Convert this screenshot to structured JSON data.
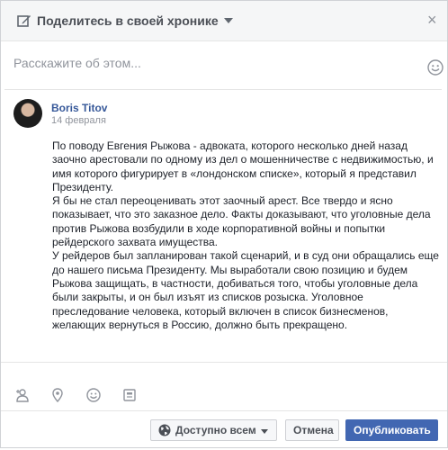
{
  "header": {
    "title": "Поделитесь в своей хронике"
  },
  "composer": {
    "placeholder": "Расскажите об этом..."
  },
  "post": {
    "author": "Boris Titov",
    "date": "14 февраля",
    "paragraphs": [
      "По поводу Евгения Рыжова - адвоката, которого несколько дней назад заочно арестовали по одному из дел о мошенничестве с недвижимостью, и имя которого фигурирует в «лондонском списке», который я представил Президенту.",
      "Я бы не стал переоценивать этот заочный арест. Все твердо и ясно показывает, что это заказное дело. Факты доказывают, что уголовные дела против Рыжова возбудили в ходе корпоративной войны и попытки рейдерского захвата имущества.",
      "У рейдеров был запланирован такой сценарий, и в суд они обращались еще до нашего письма Президенту. Мы выработали свою позицию и будем Рыжова защищать, в частности, добиваться того, чтобы уголовные дела были закрыты, и он был изъят из списков розыска. Уголовное преследование человека, который включен в список бизнесменов, желающих вернуться в Россию, должно быть прекращено."
    ]
  },
  "footer": {
    "audience_label": "Доступно всем",
    "cancel_label": "Отмена",
    "publish_label": "Опубликовать"
  },
  "colors": {
    "accent": "#4267b2",
    "link": "#365899"
  }
}
